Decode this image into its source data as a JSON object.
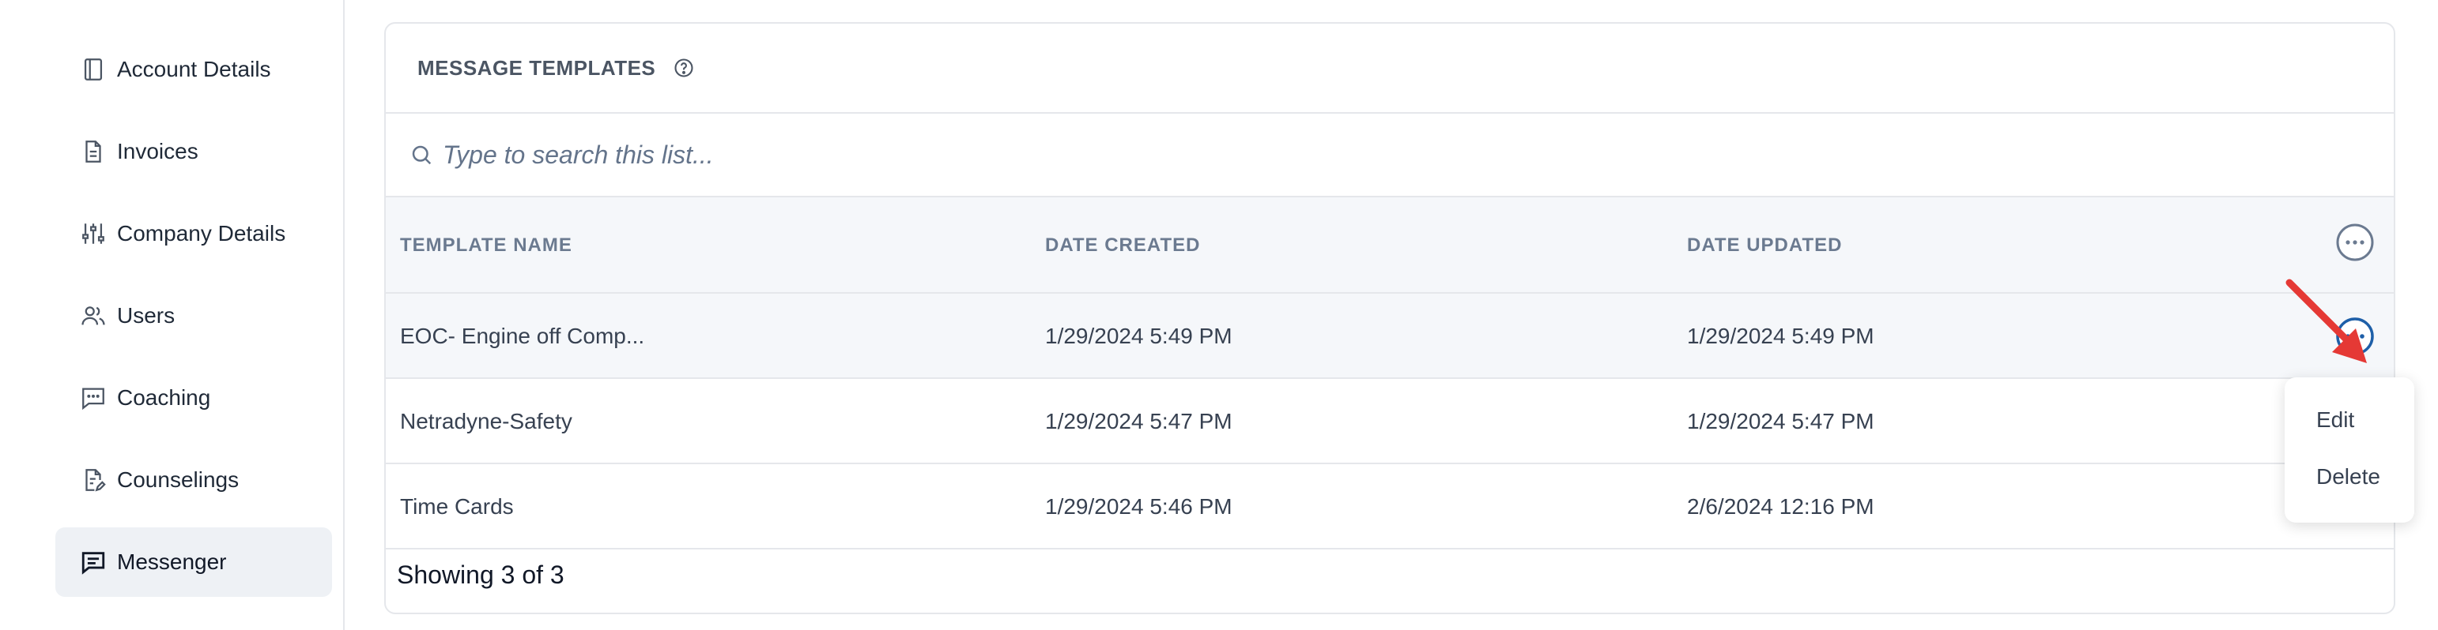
{
  "sidebar": {
    "items": [
      {
        "label": "Account Details",
        "icon": "sidebar-panel-icon"
      },
      {
        "label": "Invoices",
        "icon": "document-icon"
      },
      {
        "label": "Company Details",
        "icon": "sliders-icon"
      },
      {
        "label": "Users",
        "icon": "users-icon"
      },
      {
        "label": "Coaching",
        "icon": "chat-icon"
      },
      {
        "label": "Counselings",
        "icon": "file-edit-icon"
      },
      {
        "label": "Messenger",
        "icon": "message-icon",
        "active": true
      }
    ]
  },
  "card": {
    "title": "MESSAGE TEMPLATES",
    "search_placeholder": "Type to search this list..."
  },
  "table": {
    "headers": {
      "name": "TEMPLATE NAME",
      "created": "DATE CREATED",
      "updated": "DATE UPDATED"
    },
    "rows": [
      {
        "name": "EOC- Engine off Comp...",
        "created": "1/29/2024 5:49 PM",
        "updated": "1/29/2024 5:49 PM"
      },
      {
        "name": "Netradyne-Safety",
        "created": "1/29/2024 5:47 PM",
        "updated": "1/29/2024 5:47 PM"
      },
      {
        "name": "Time Cards",
        "created": "1/29/2024 5:46 PM",
        "updated": "2/6/2024 12:16 PM"
      }
    ],
    "footer": "Showing 3 of 3"
  },
  "dropdown": {
    "items": [
      "Edit",
      "Delete"
    ]
  },
  "colors": {
    "accent": "#1e5fa8",
    "arrow": "#e53935",
    "active_bg": "#eef1f5"
  }
}
